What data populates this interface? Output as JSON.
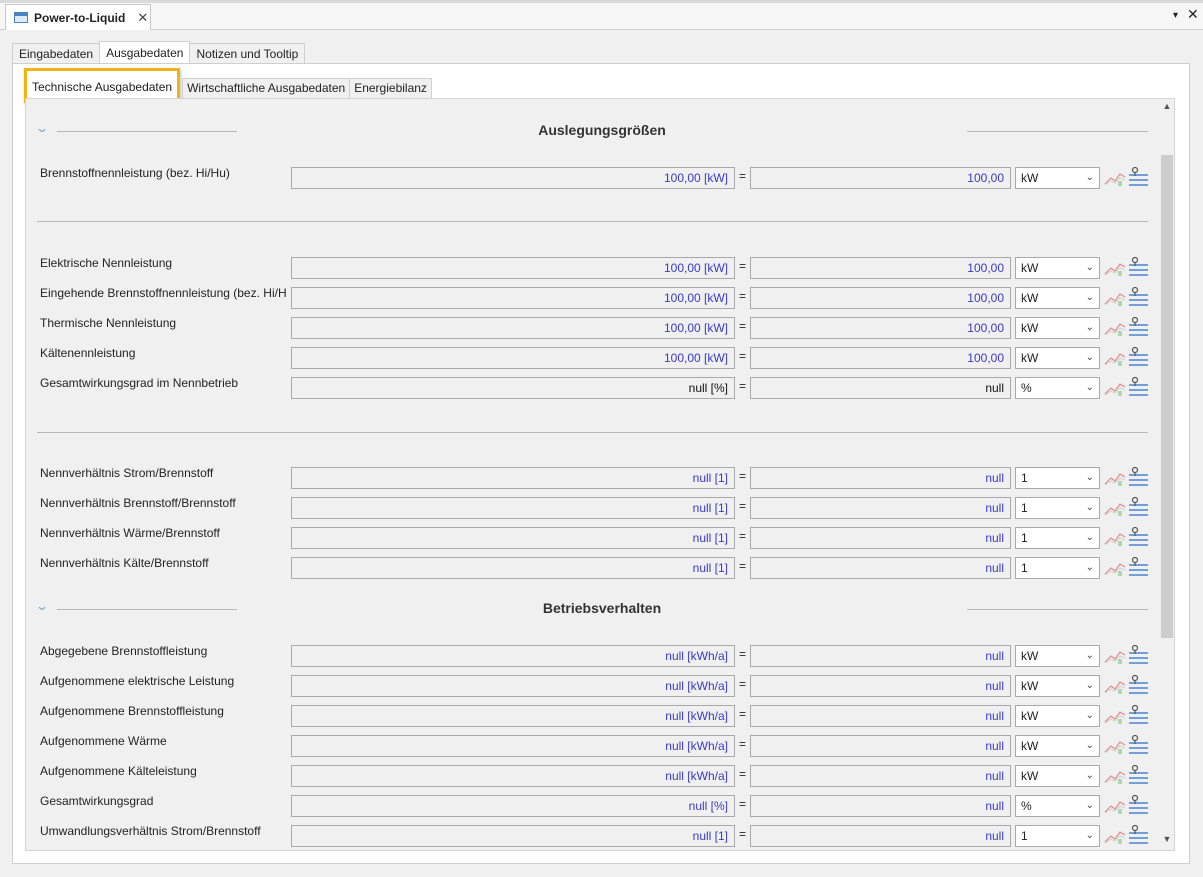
{
  "editor": {
    "tab_title": "Power-to-Liquid",
    "close_glyph": "✕",
    "menu_glyph": "▾",
    "x_glyph": "✕"
  },
  "outer_tabs": [
    "Eingabedaten",
    "Ausgabedaten",
    "Notizen und Tooltip"
  ],
  "inner_tabs": [
    "Technische Ausgabedaten",
    "Wirtschaftliche Ausgabedaten",
    "Energiebilanz"
  ],
  "sections": {
    "auslegung": "Auslegungsgrößen",
    "betrieb": "Betriebsverhalten"
  },
  "eq": "=",
  "rows": [
    {
      "label": "Brennstoffnennleistung (bez. Hi/Hu)",
      "value": "100,00 [kW]",
      "converted": "100,00",
      "unit": "kW"
    },
    {
      "label": "Elektrische Nennleistung",
      "value": "100,00 [kW]",
      "converted": "100,00",
      "unit": "kW"
    },
    {
      "label": "Eingehende Brennstoffnennleistung (bez. Hi/H",
      "value": "100,00 [kW]",
      "converted": "100,00",
      "unit": "kW"
    },
    {
      "label": "Thermische Nennleistung",
      "value": "100,00 [kW]",
      "converted": "100,00",
      "unit": "kW"
    },
    {
      "label": "Kältenennleistung",
      "value": "100,00 [kW]",
      "converted": "100,00",
      "unit": "kW"
    },
    {
      "label": "Gesamtwirkungsgrad im Nennbetrieb",
      "value": "null [%]",
      "converted": "null",
      "unit": "%"
    },
    {
      "label": "Nennverhältnis Strom/Brennstoff",
      "value": "null [1]",
      "converted": "null",
      "unit": "1"
    },
    {
      "label": "Nennverhältnis Brennstoff/Brennstoff",
      "value": "null [1]",
      "converted": "null",
      "unit": "1"
    },
    {
      "label": "Nennverhältnis Wärme/Brennstoff",
      "value": "null [1]",
      "converted": "null",
      "unit": "1"
    },
    {
      "label": "Nennverhältnis Kälte/Brennstoff",
      "value": "null [1]",
      "converted": "null",
      "unit": "1"
    },
    {
      "label": "Abgegebene Brennstoffleistung",
      "value": "null [kWh/a]",
      "converted": "null",
      "unit": "kW"
    },
    {
      "label": "Aufgenommene elektrische Leistung",
      "value": "null [kWh/a]",
      "converted": "null",
      "unit": "kW"
    },
    {
      "label": "Aufgenommene Brennstoffleistung",
      "value": "null [kWh/a]",
      "converted": "null",
      "unit": "kW"
    },
    {
      "label": "Aufgenommene Wärme",
      "value": "null [kWh/a]",
      "converted": "null",
      "unit": "kW"
    },
    {
      "label": "Aufgenommene Kälteleistung",
      "value": "null [kWh/a]",
      "converted": "null",
      "unit": "kW"
    },
    {
      "label": "Gesamtwirkungsgrad",
      "value": "null [%]",
      "converted": "null",
      "unit": "%"
    },
    {
      "label": "Umwandlungsverhältnis Strom/Brennstoff",
      "value": "null [1]",
      "converted": "null",
      "unit": "1"
    }
  ],
  "colors": {
    "highlight": "#f0b417",
    "value_text": "#3a3acb"
  },
  "icons": [
    "chart-icon",
    "list-pin-icon",
    "chevron-down-icon"
  ]
}
